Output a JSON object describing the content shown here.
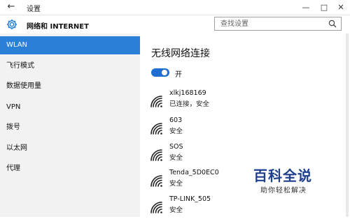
{
  "window": {
    "title": "设置"
  },
  "header": {
    "title": "网络和 INTERNET",
    "search_placeholder": "查找设置"
  },
  "sidebar": {
    "items": [
      {
        "label": "WLAN",
        "active": true
      },
      {
        "label": "飞行模式",
        "active": false
      },
      {
        "label": "数据使用量",
        "active": false
      },
      {
        "label": "VPN",
        "active": false
      },
      {
        "label": "拨号",
        "active": false
      },
      {
        "label": "以太网",
        "active": false
      },
      {
        "label": "代理",
        "active": false
      }
    ]
  },
  "main": {
    "title": "无线网络连接",
    "toggle_label": "开",
    "toggle_on": true,
    "networks": [
      {
        "name": "xlkj168169",
        "status": "已连接，安全"
      },
      {
        "name": "603",
        "status": "安全"
      },
      {
        "name": "SOS",
        "status": "安全"
      },
      {
        "name": "Tenda_5D0EC0",
        "status": "安全"
      },
      {
        "name": "TP-LINK_505",
        "status": "安全"
      }
    ]
  },
  "watermark": {
    "title": "百科全说",
    "subtitle": "助你轻松解决"
  },
  "colors": {
    "accent": "#2a7fd6",
    "toggle": "#1e6fd1",
    "sidebar_bg": "#f2f2f2",
    "watermark": "#1c3f8e"
  }
}
